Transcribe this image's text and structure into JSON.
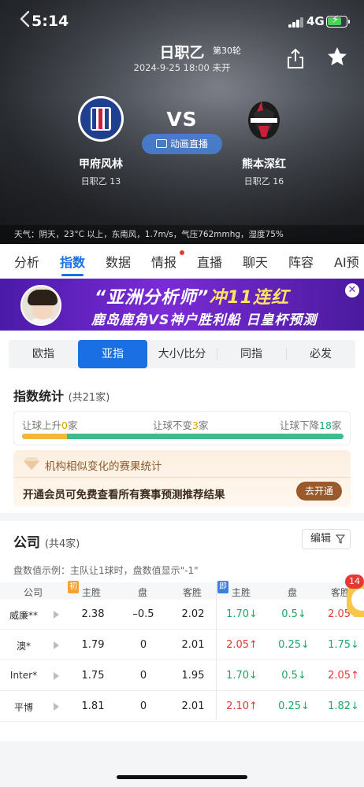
{
  "status": {
    "time": "5:14",
    "network": "4G"
  },
  "header": {
    "league": "日职乙",
    "round": "第30轮",
    "datetime": "2024-9-25 18:00 未开",
    "vs": "VS",
    "live_button": "动画直播",
    "weather": "天气：阴天，23°C 以上，东南风，1.7m/s，气压762mmhg，湿度75%"
  },
  "home": {
    "name": "甲府风林",
    "info": "日职乙 13"
  },
  "away": {
    "name": "熊本深红",
    "info": "日职乙 16"
  },
  "tabs": [
    "分析",
    "指数",
    "数据",
    "情报",
    "直播",
    "聊天",
    "阵容",
    "AI预"
  ],
  "banner": {
    "line1_a": "“亚洲分析师”",
    "line1_b": "冲11连红",
    "line2": "鹿岛鹿角VS神户胜利船 日皇杯预测"
  },
  "subtabs": [
    "欧指",
    "亚指",
    "大小/比分",
    "同指",
    "必发"
  ],
  "stats": {
    "title": "指数统计",
    "count": "(共21家)",
    "up_label": "让球上升",
    "up_value": "0",
    "same_label": "让球不变",
    "same_value": "3",
    "down_label": "让球下降",
    "down_value": "18",
    "unit": "家",
    "up_fraction": 0.14
  },
  "vip": {
    "title": "机构相似变化的赛果统计",
    "desc": "开通会员可免费查看所有赛事预测推荐结果",
    "button": "去开通"
  },
  "company": {
    "title": "公司",
    "count": "(共4家)",
    "edit": "编辑",
    "hint": "盘数值示例：主队让1球时，盘数值显示\"-1\"",
    "headers": {
      "company": "公司",
      "init_flag": "初",
      "now_flag": "即",
      "home": "主胜",
      "pan": "盘",
      "away": "客胜"
    },
    "rows": [
      {
        "name": "威廉**",
        "h1": "2.38",
        "p1": "–0.5",
        "a1": "2.02",
        "h2": "1.70↓",
        "p2": "0.5↓",
        "a2": "2.05↑"
      },
      {
        "name": "澳*",
        "h1": "1.79",
        "p1": "0",
        "a1": "2.01",
        "h2": "2.05↑",
        "p2": "0.25↓",
        "a2": "1.75↓"
      },
      {
        "name": "Inter*",
        "h1": "1.75",
        "p1": "0",
        "a1": "1.95",
        "h2": "1.70↓",
        "p2": "0.5↓",
        "a2": "2.05↑"
      },
      {
        "name": "平博",
        "h1": "1.81",
        "p1": "0",
        "a1": "2.01",
        "h2": "2.10↑",
        "p2": "0.25↓",
        "a2": "1.82↓"
      }
    ]
  },
  "float_badge": "14",
  "colors": {
    "accent": "#1a6fe3",
    "up": "#e53935",
    "down": "#1da865",
    "vip_button": "#9a5a2c"
  }
}
